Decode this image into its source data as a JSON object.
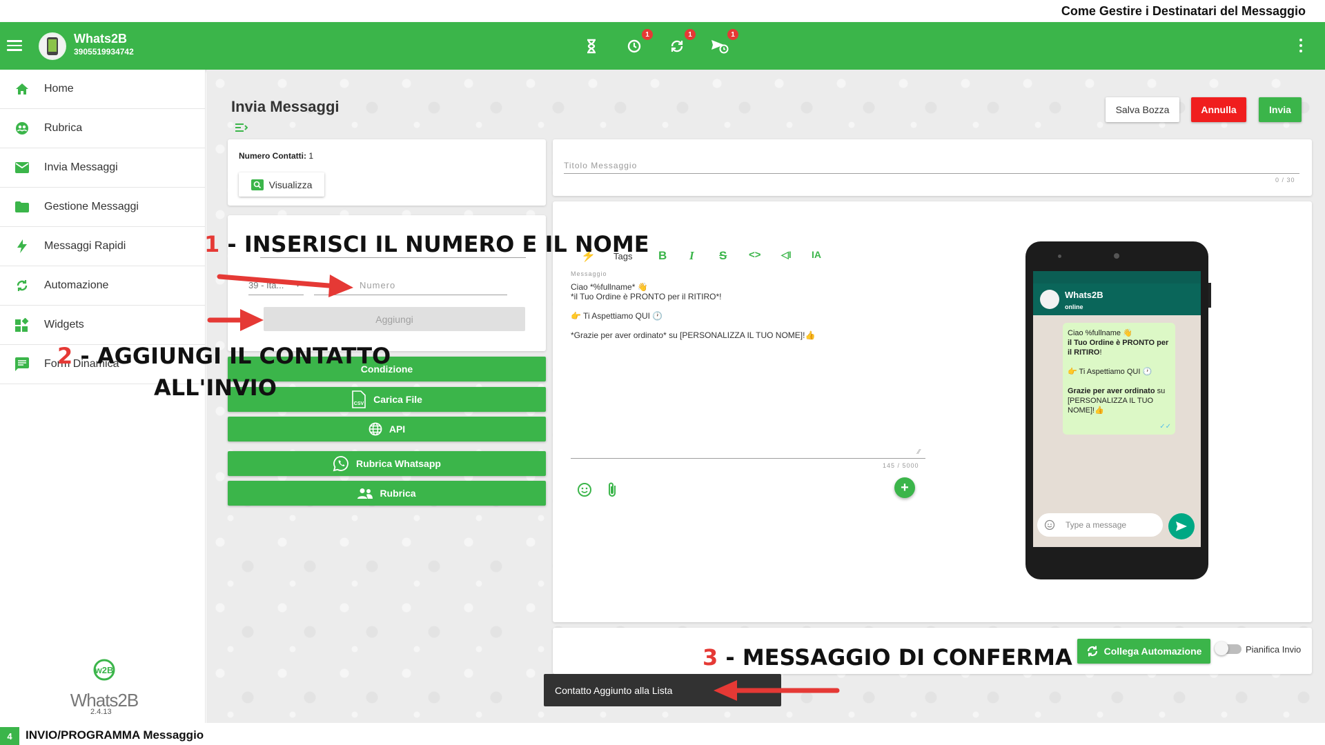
{
  "header_caption": "Come Gestire i Destinatari del Messaggio",
  "appbar": {
    "name": "Whats2B",
    "phone": "3905519934742",
    "badges": [
      "1",
      "1",
      "1"
    ]
  },
  "sidebar": {
    "items": [
      {
        "label": "Home",
        "icon": "home-icon"
      },
      {
        "label": "Rubrica",
        "icon": "contacts-icon"
      },
      {
        "label": "Invia Messaggi",
        "icon": "mail-icon"
      },
      {
        "label": "Gestione Messaggi",
        "icon": "folder-icon"
      },
      {
        "label": "Messaggi Rapidi",
        "icon": "bolt-icon"
      },
      {
        "label": "Automazione",
        "icon": "sync-icon"
      },
      {
        "label": "Widgets",
        "icon": "widgets-icon"
      },
      {
        "label": "Form Dinamica",
        "icon": "form-icon"
      }
    ],
    "logo_text": "Whats2B",
    "version": "2.4.13"
  },
  "page": {
    "title": "Invia Messaggi",
    "save_draft": "Salva Bozza",
    "cancel": "Annulla",
    "send": "Invia"
  },
  "contacts_card": {
    "count_label": "Numero Contatti:",
    "count_value": "1",
    "view_button": "Visualizza"
  },
  "add_form": {
    "prefix_value": "39 - Ita...",
    "number_placeholder": "Numero",
    "add_button": "Aggiungi"
  },
  "source_buttons": {
    "condizione": "Condizione",
    "carica_file": "Carica File",
    "api": "API",
    "rubrica_whatsapp": "Rubrica Whatsapp",
    "rubrica": "Rubrica"
  },
  "title_field": {
    "placeholder": "Titolo Messaggio",
    "counter": "0 / 30"
  },
  "editor": {
    "tags_label": "Tags",
    "message_label": "Messaggio",
    "line1": "Ciao *%fullname* 👋",
    "line2": "*il Tuo Ordine è PRONTO per il RITIRO*!",
    "line3": "👉 Ti Aspettiamo QUI 🕐",
    "line4": "*Grazie per aver ordinato* su [PERSONALIZZA IL TUO NOME]!👍",
    "counter": "145 / 5000"
  },
  "phone_preview": {
    "contact_name": "Whats2B",
    "status": "online",
    "bubble_line1": "Ciao %fullname 👋",
    "bubble_line2": "il Tuo Ordine è PRONTO per il RITIRO",
    "bubble_line2_tail": "!",
    "bubble_line3": "👉 Ti Aspettiamo QUI 🕐",
    "bubble_line4_bold": "Grazie per aver ordinato",
    "bubble_line4_rest": " su [PERSONALIZZA IL TUO NOME]!👍",
    "input_placeholder": "Type a message"
  },
  "bottom_card": {
    "automation_button": "Collega Automazione",
    "schedule_label": "Pianifica Invio"
  },
  "annotations": {
    "step1_num": "1",
    "step1_text": " - INSERISCI IL NUMERO E IL NOME",
    "step2_num": "2",
    "step2_text": " - AGGIUNGI IL CONTATTO",
    "step2_text2": "ALL'INVIO",
    "step3_num": "3",
    "step3_text": " - MESSAGGIO DI CONFERMA"
  },
  "toast": "Contatto Aggiunto alla Lista",
  "footer": {
    "step_number": "4",
    "label": "INVIO/PROGRAMMA Messaggio"
  },
  "colors": {
    "brand_green": "#3bb54a",
    "danger_red": "#f01e1e",
    "annotation_red": "#e53935",
    "toast_bg": "#323232",
    "whatsapp_teal": "#0a665a"
  }
}
